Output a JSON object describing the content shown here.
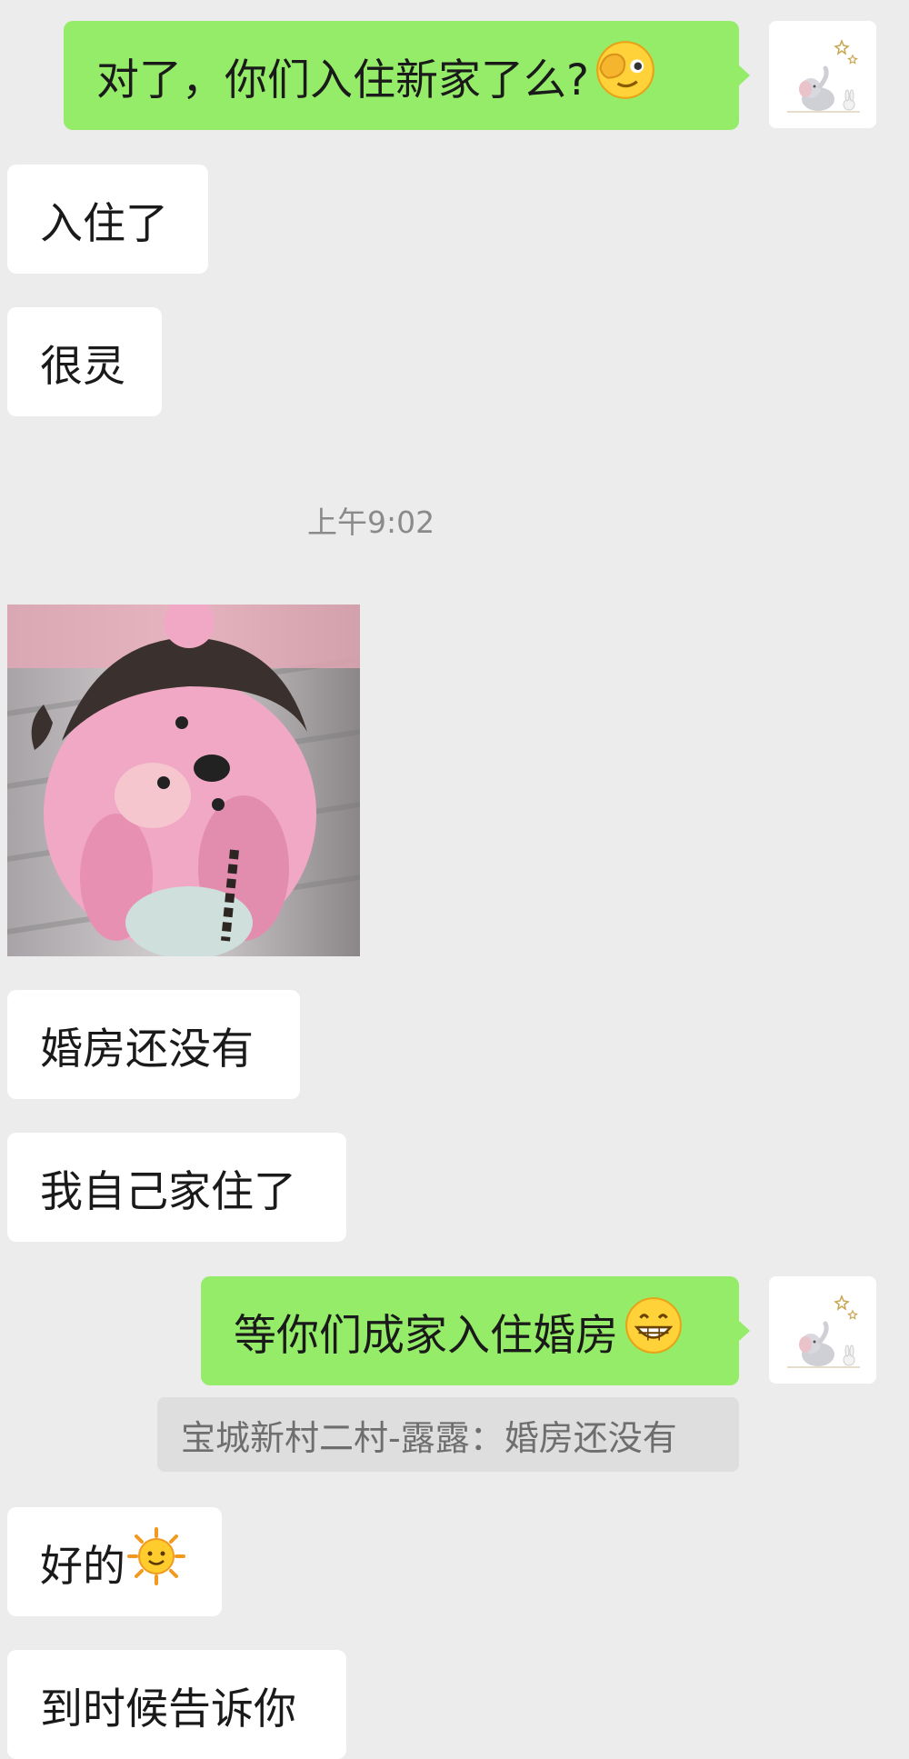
{
  "messages": {
    "m1": {
      "text": "对了，你们入住新家了么?",
      "emoji": "face-with-hand-over-eye"
    },
    "m2": {
      "text": "入住了"
    },
    "m3": {
      "text": "很灵"
    },
    "timestamp": "上午9:02",
    "sticker": {
      "icon": "pink-cartoon-beaver-sticker"
    },
    "m4": {
      "text": "婚房还没有"
    },
    "m5": {
      "text": "我自己家住了"
    },
    "m6": {
      "text": "等你们成家入住婚房",
      "emoji": "grinning-face"
    },
    "quote": {
      "text": "宝城新村二村-露露：婚房还没有"
    },
    "m7": {
      "text": "好的",
      "emoji": "sun-with-face"
    },
    "m8": {
      "text": "到时候告诉你"
    }
  },
  "avatar": {
    "icon": "elephant-and-stars-avatar"
  },
  "colors": {
    "background": "#ececec",
    "outgoing_bubble": "#95ec69",
    "incoming_bubble": "#ffffff",
    "quote_background": "#dedede"
  }
}
